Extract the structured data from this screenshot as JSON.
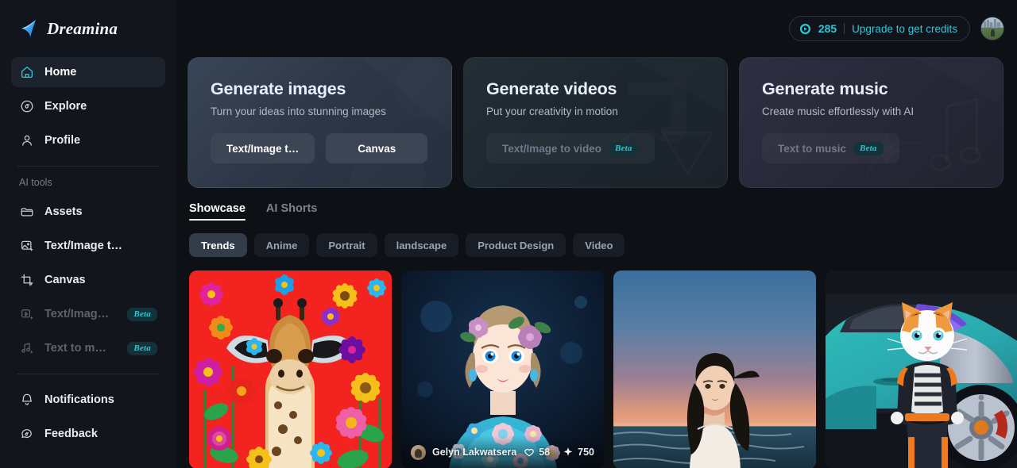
{
  "brand": {
    "name": "Dreamina",
    "logo_icon": "star-sparkle-icon"
  },
  "sidebar": {
    "primary_items": [
      {
        "label": "Home",
        "icon": "home-icon",
        "active": true
      },
      {
        "label": "Explore",
        "icon": "compass-icon",
        "active": false
      },
      {
        "label": "Profile",
        "icon": "user-icon",
        "active": false
      }
    ],
    "section_label": "AI tools",
    "tool_items": [
      {
        "label": "Assets",
        "icon": "folder-icon",
        "badge": "",
        "disabled": false
      },
      {
        "label": "Text/Image t…",
        "icon": "image-sparkle-icon",
        "badge": "",
        "disabled": false
      },
      {
        "label": "Canvas",
        "icon": "canvas-frame-icon",
        "badge": "",
        "disabled": false
      },
      {
        "label": "Text/Image t…",
        "icon": "video-sparkle-icon",
        "badge": "Beta",
        "disabled": true
      },
      {
        "label": "Text to music",
        "icon": "music-note-sparkle-icon",
        "badge": "Beta",
        "disabled": true
      }
    ],
    "bottom_items": [
      {
        "label": "Notifications",
        "icon": "bell-icon"
      },
      {
        "label": "Feedback",
        "icon": "chat-bubble-icon"
      }
    ]
  },
  "header": {
    "credits": {
      "icon": "credit-coin-icon",
      "amount": "285",
      "upgrade_label": "Upgrade to get credits"
    },
    "avatar_alt": "user-avatar"
  },
  "heroes": [
    {
      "title": "Generate images",
      "subtitle": "Turn your ideas into stunning images",
      "buttons": [
        {
          "label": "Text/Image t…",
          "badge": "",
          "muted": false
        },
        {
          "label": "Canvas",
          "badge": "",
          "muted": false
        }
      ]
    },
    {
      "title": "Generate videos",
      "subtitle": "Put your creativity in motion",
      "buttons": [
        {
          "label": "Text/Image to video",
          "badge": "Beta",
          "muted": true
        }
      ]
    },
    {
      "title": "Generate music",
      "subtitle": "Create music effortlessly with AI",
      "buttons": [
        {
          "label": "Text to music",
          "badge": "Beta",
          "muted": true
        }
      ]
    }
  ],
  "tabs": [
    {
      "label": "Showcase",
      "active": true
    },
    {
      "label": "AI Shorts",
      "active": false
    }
  ],
  "chips": [
    {
      "label": "Trends",
      "active": true
    },
    {
      "label": "Anime",
      "active": false
    },
    {
      "label": "Portrait",
      "active": false
    },
    {
      "label": "landscape",
      "active": false
    },
    {
      "label": "Product Design",
      "active": false
    },
    {
      "label": "Video",
      "active": false
    }
  ],
  "gallery": [
    {
      "art": "giraffe-flowers",
      "overlay": null
    },
    {
      "art": "doll-woman-floral",
      "overlay": {
        "author": "Gelyn Lakwatsera",
        "likes": "58",
        "sparkles": "750",
        "like_icon": "heart-icon",
        "sparkle_icon": "sparkle-icon"
      }
    },
    {
      "art": "beach-sunset-woman",
      "overlay": null
    },
    {
      "art": "cat-sports-car",
      "overlay": null
    }
  ],
  "colors": {
    "accent_cyan": "#2fc7d8",
    "sidebar_bg": "#12161c",
    "page_bg": "#0d1014",
    "active_nav_bg": "#1d232c",
    "chip_active_bg": "#333c49"
  }
}
